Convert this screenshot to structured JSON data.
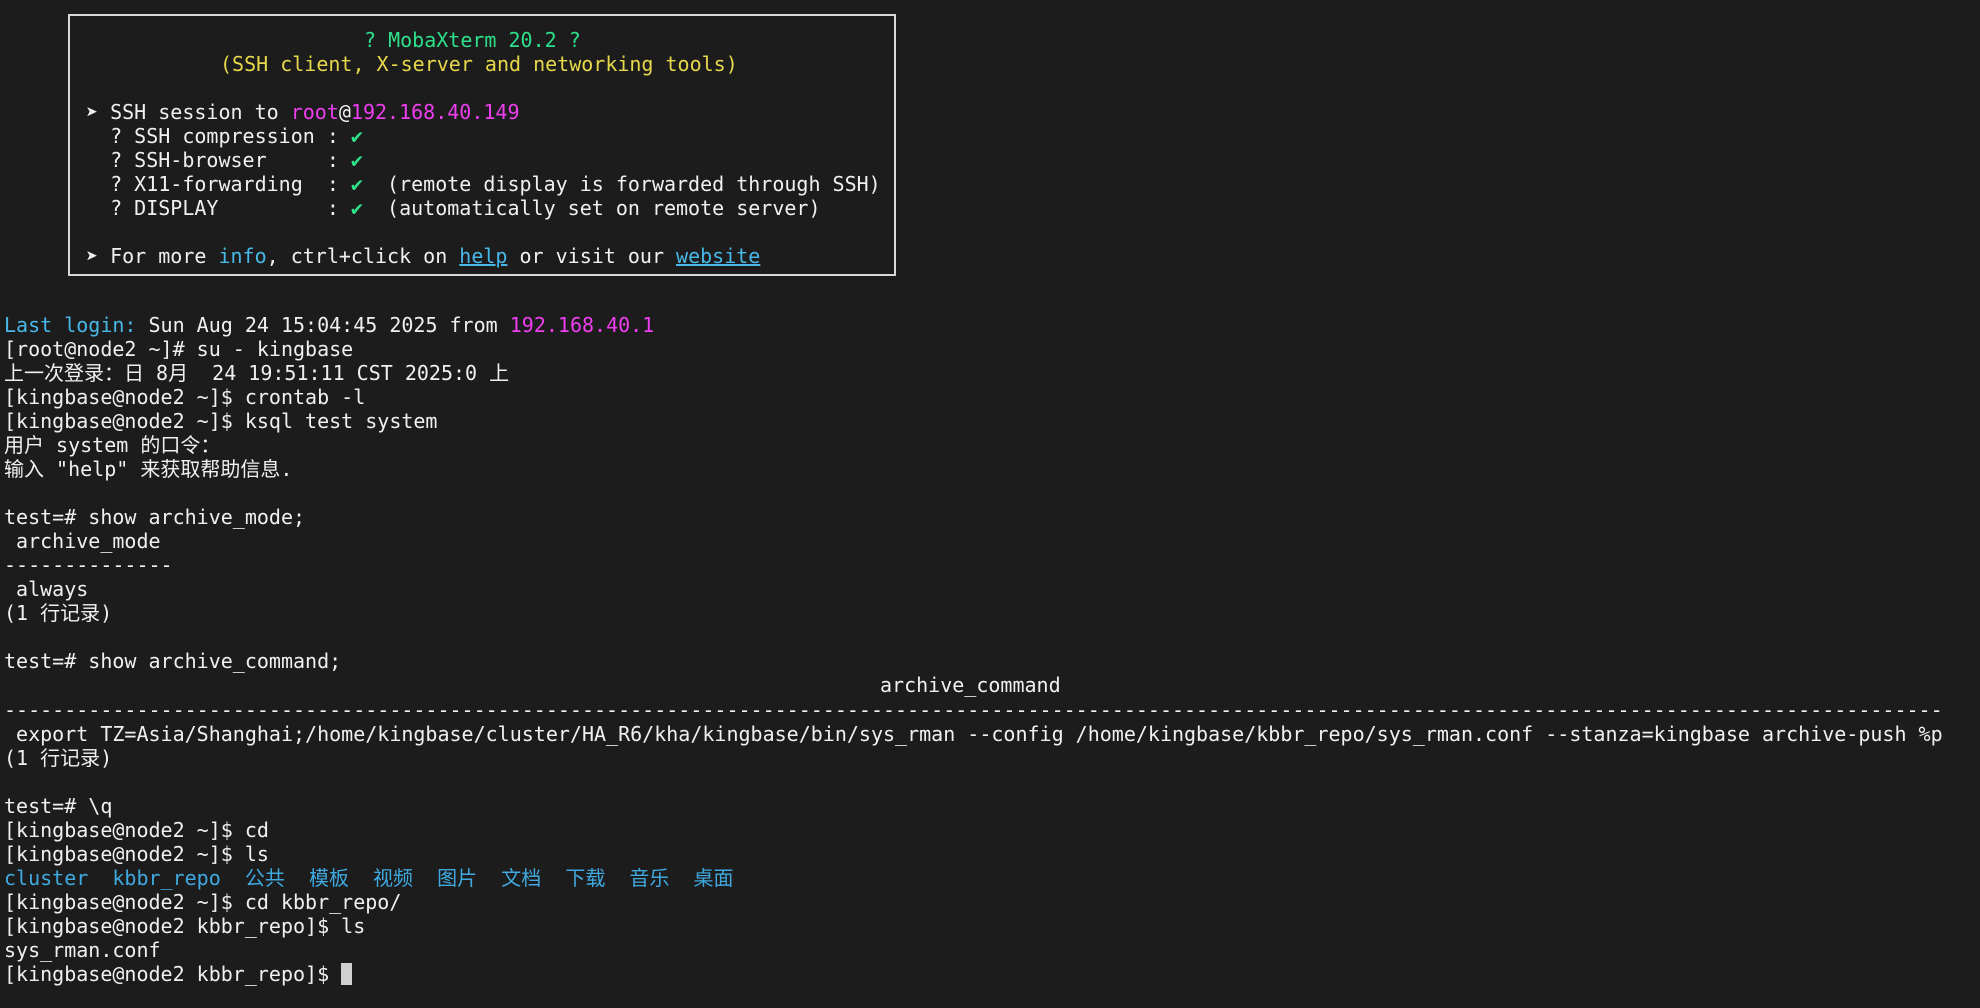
{
  "banner": {
    "title": "? MobaXterm 20.2 ?",
    "subtitle": "(SSH client, X-server and networking tools)",
    "ssh_prefix": "➤ SSH session to ",
    "ssh_user": "root",
    "ssh_at": "@",
    "ssh_host": "192.168.40.149",
    "features": [
      {
        "label": "  ? SSH compression : ",
        "check": "✔",
        "note": ""
      },
      {
        "label": "  ? SSH-browser     : ",
        "check": "✔",
        "note": ""
      },
      {
        "label": "  ? X11-forwarding  : ",
        "check": "✔",
        "note": "  (remote display is forwarded through SSH)"
      },
      {
        "label": "  ? DISPLAY         : ",
        "check": "✔",
        "note": "  (automatically set on remote server)"
      }
    ],
    "more_prefix": "➤ For more ",
    "more_info": "info",
    "more_mid": ", ctrl+click on ",
    "more_help": "help",
    "more_or": " or visit our ",
    "more_website": "website"
  },
  "session": {
    "last_login_label": "Last login:",
    "last_login_text": " Sun Aug 24 15:04:45 2025 from ",
    "last_login_ip": "192.168.40.1",
    "lines": [
      "[root@node2 ~]# su - kingbase",
      "上一次登录：日 8月  24 19:51:11 CST 2025:0 上",
      "[kingbase@node2 ~]$ crontab -l",
      "[kingbase@node2 ~]$ ksql test system",
      "用户 system 的口令：",
      "输入 \"help\" 来获取帮助信息.",
      "",
      "test=# show archive_mode;",
      " archive_mode",
      "--------------",
      " always",
      "(1 行记录)",
      "",
      "test=# show archive_command;"
    ],
    "archive_command_header": "archive_command",
    "dashes": "--------------------------------------------------------------------------------------------------------------------------------------------------------------------------",
    "archive_command_value": " export TZ=Asia/Shanghai;/home/kingbase/cluster/HA_R6/kha/kingbase/bin/sys_rman --config /home/kingbase/kbbr_repo/sys_rman.conf --stanza=kingbase archive-push %p",
    "lines2": [
      "(1 行记录)",
      "",
      "test=# \\q",
      "[kingbase@node2 ~]$ cd",
      "[kingbase@node2 ~]$ ls"
    ],
    "ls_items": [
      "cluster",
      "kbbr_repo",
      "公共",
      "模板",
      "视频",
      "图片",
      "文档",
      "下载",
      "音乐",
      "桌面"
    ],
    "lines3": [
      "[kingbase@node2 ~]$ cd kbbr_repo/",
      "[kingbase@node2 kbbr_repo]$ ls",
      "sys_rman.conf"
    ],
    "prompt": "[kingbase@node2 kbbr_repo]$ "
  },
  "colors": {
    "background": "#1c1c1c",
    "green": "#2ee08a",
    "yellow": "#e6d84a",
    "magenta": "#ee3ef0",
    "cyan": "#47b8e8"
  }
}
